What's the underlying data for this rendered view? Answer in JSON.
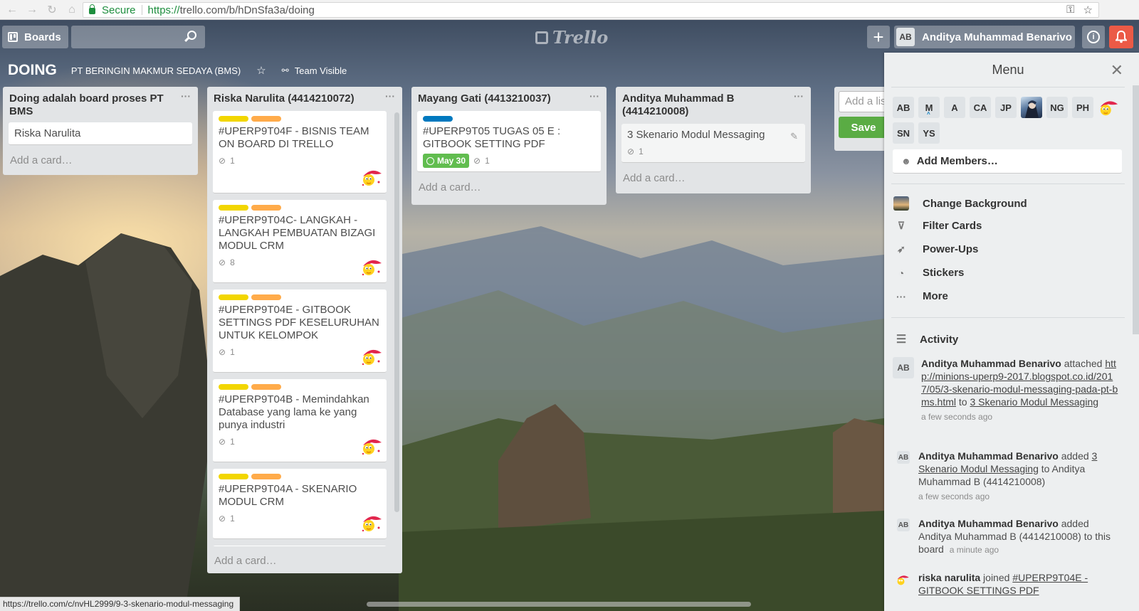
{
  "browser": {
    "secure_label": "Secure",
    "url_protocol": "https://",
    "url_rest": "trello.com/b/hDnSfa3a/doing"
  },
  "header": {
    "boards_label": "Boards",
    "logo_text": "Trello",
    "user_initials": "AB",
    "user_name": "Anditya Muhammad Benarivo",
    "info_glyph": "i",
    "add_glyph": "+"
  },
  "board": {
    "title": "DOING",
    "team": "PT BERINGIN MAKMUR SEDAYA (BMS)",
    "visibility": "Team Visible"
  },
  "lists": [
    {
      "name": "Doing adalah board proses PT BMS",
      "cards": [
        {
          "title": "Riska Narulita"
        }
      ],
      "add_card": "Add a card…"
    },
    {
      "name": "Riska Narulita (4414210072)",
      "cards": [
        {
          "title": "#UPERP9T04F - BISNIS TEAM ON BOARD DI TRELLO",
          "attachments": "1"
        },
        {
          "title": "#UPERP9T04C- LANGKAH - LANGKAH PEMBUATAN BIZAGI MODUL CRM",
          "attachments": "8"
        },
        {
          "title": "#UPERP9T04E - GITBOOK SETTINGS PDF KESELURUHAN UNTUK KELOMPOK",
          "attachments": "1"
        },
        {
          "title": "#UPERP9T04B - Memindahkan Database yang lama ke yang punya industri",
          "attachments": "1"
        },
        {
          "title": "#UPERP9T04A - SKENARIO MODUL CRM",
          "attachments": "1"
        }
      ],
      "add_card": "Add a card…"
    },
    {
      "name": "Mayang Gati (4413210037)",
      "cards": [
        {
          "title": "#UPERP9T05 TUGAS 05 E : GITBOOK SETTING PDF",
          "due": "May 30",
          "attachments": "1"
        }
      ],
      "add_card": "Add a card…"
    },
    {
      "name": "Anditya Muhammad B (4414210008)",
      "cards": [
        {
          "title": "3 Skenario Modul Messaging",
          "attachments": "1"
        }
      ],
      "add_card": "Add a card…"
    }
  ],
  "add_list": {
    "placeholder": "Add a list…",
    "save_label": "Save"
  },
  "menu": {
    "title": "Menu",
    "members": [
      "AB",
      "M",
      "A",
      "CA",
      "JP",
      "",
      "NG",
      "PH",
      "",
      "SN",
      "YS"
    ],
    "add_members": "Add Members…",
    "items": [
      "Change Background",
      "Filter Cards",
      "Power-Ups",
      "Stickers",
      "More"
    ],
    "activity_label": "Activity",
    "activities": [
      {
        "initials": "AB",
        "user": "Anditya Muhammad Benarivo",
        "verb": " attached ",
        "link1": "http://minions-uperp9-2017.blogspot.co.id/2017/05/3-skenario-modul-messaging-pada-pt-bms.html",
        "mid": " to ",
        "link2": "3 Skenario Modul Messaging",
        "time": "a few seconds ago"
      },
      {
        "initials": "AB",
        "user": "Anditya Muhammad Benarivo",
        "verb": " added ",
        "link1": "3 Skenario Modul Messaging",
        "mid": " to Anditya Muhammad B (4414210008)",
        "time": "a few seconds ago"
      },
      {
        "initials": "AB",
        "user": "Anditya Muhammad Benarivo",
        "verb": " added Anditya Muhammad B (4414210008) to this board",
        "time": "a minute ago"
      },
      {
        "user": "riska narulita",
        "verb": " joined ",
        "link1": "#UPERP9T04E - GITBOOK SETTINGS PDF"
      }
    ]
  },
  "status_bar": "https://trello.com/c/nvHL2999/9-3-skenario-modul-messaging",
  "colors": {
    "label_yellow": "#f2d600",
    "label_orange": "#ffab4a",
    "label_blue": "#0079bf",
    "due_green": "#61bd4f",
    "save_green": "#5aac44",
    "notification_red": "#eb5a46"
  }
}
